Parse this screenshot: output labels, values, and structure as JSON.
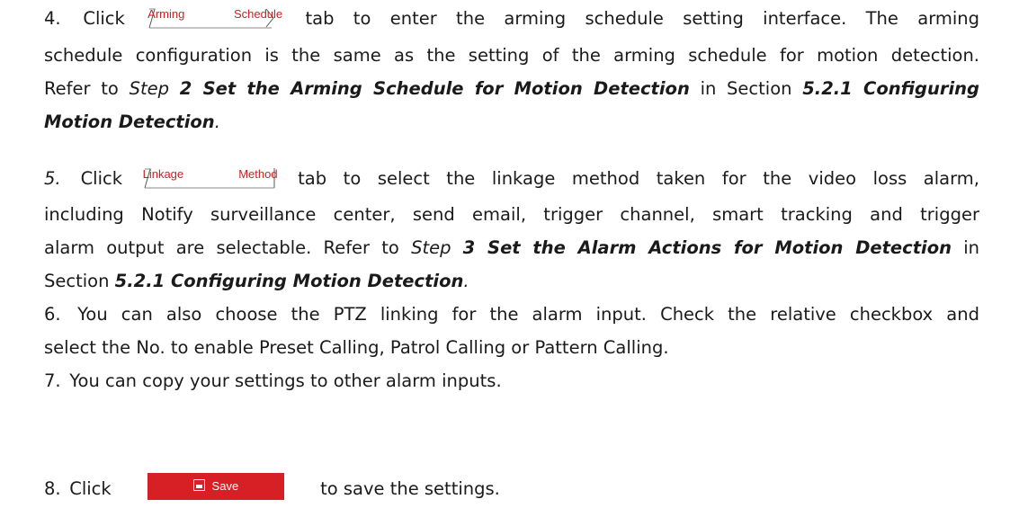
{
  "step4": {
    "num": "4.",
    "click": "Click",
    "button": "Arming Schedule",
    "l1_rest": "tab to enter the arming schedule setting interface. The arming",
    "l2": "schedule configuration is the same as the setting of the arming schedule for motion detection.",
    "l3_refer": "Refer to",
    "l3_step": "Step",
    "l3_bold": "2 Set the Arming Schedule for Motion Detection",
    "l3_in": "in Section",
    "l3_sec": "5.2.1 Configuring",
    "l4_bold": "Motion Detection",
    "l4_dot": "."
  },
  "step5": {
    "num": "5.",
    "click": "Click",
    "button": "Linkage Method",
    "l1_rest": "tab to select the linkage method taken for the video loss alarm,",
    "l2": "including Notify surveillance center, send email, trigger channel, smart tracking and trigger",
    "l3_a": "alarm output are selectable. Refer to",
    "l3_step": "Step",
    "l3_bold": "3 Set the Alarm Actions for Motion Detection",
    "l3_in": "in",
    "l4_section": "Section",
    "l4_bold": "5.2.1 Configuring Motion Detection",
    "l4_dot": "."
  },
  "step6": {
    "num": "6.",
    "l1": "You can also choose the PTZ linking for the alarm input. Check the relative checkbox and",
    "l2": "select the No. to enable Preset Calling, Patrol Calling or Pattern Calling."
  },
  "step7": {
    "num": "7.",
    "l1": "You can copy your settings to other alarm inputs."
  },
  "step8": {
    "num": "8.",
    "click": "Click",
    "button": "Save",
    "button_icon": "floppy-disk-icon",
    "rest": "to save the settings."
  },
  "colors": {
    "accent": "#d71f26",
    "tab_text": "#cc1f26"
  }
}
